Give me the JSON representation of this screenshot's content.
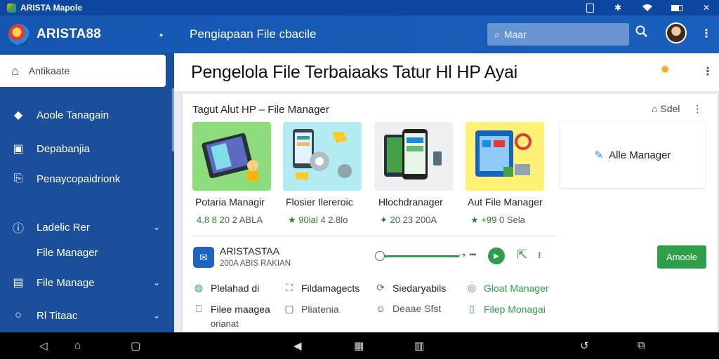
{
  "statusbar": {
    "app_name": "ARISTA Mapole"
  },
  "appbar": {
    "brand": "ARISTA88",
    "title": "Pengiapaan File cbacile",
    "search_placeholder": "Maar"
  },
  "sidebar": {
    "active": "Antikaate",
    "items": [
      {
        "label": "Aoole Tanagain"
      },
      {
        "label": "Depabanjia"
      },
      {
        "label": "Penaycopaidrionk"
      },
      {
        "label": "Ladelic Rer"
      },
      {
        "label": "File Manager"
      },
      {
        "label": "File Manage"
      },
      {
        "label": "Rl Titaac"
      }
    ]
  },
  "main": {
    "title": "Pengelola File Terbaiaaks Tatur Hl HP Ayai",
    "card": {
      "title": "Tagut Alut HP – File Manager",
      "options_label": "Sdel",
      "apps": [
        {
          "name": "Potaria Managir",
          "meta": "4,8 8 20",
          "meta_sub": "2 ABLA"
        },
        {
          "name": "Flosier Ilereroic",
          "meta": "★ 90ial",
          "meta_sub": "4 2.8lo"
        },
        {
          "name": "Hlochdranager",
          "meta": "✦ 20",
          "meta_sub": "23 200A"
        },
        {
          "name": "Aut File Manager",
          "meta": "★ +99",
          "meta_sub": "0 Sela"
        }
      ],
      "side_card": "Alle Manager",
      "lead": {
        "title": "ARISTASTAA",
        "subtitle": "200A ABIS RAKIAN"
      },
      "button": "Amoole",
      "options": [
        {
          "label": "Plelahad di"
        },
        {
          "label": "Fildamagects"
        },
        {
          "label": "Siedaryabils"
        },
        {
          "label": "Gloat Manager"
        },
        {
          "label": "Filee maagea"
        },
        {
          "label": "Pliatenia"
        },
        {
          "label": "Deaae Sfst"
        },
        {
          "label": "Filep Monagai"
        }
      ],
      "option_extra": "orianat"
    }
  },
  "colors": {
    "primary": "#1556b0",
    "sidebar": "#1b4f9c",
    "accent_green": "#2e9e48"
  }
}
